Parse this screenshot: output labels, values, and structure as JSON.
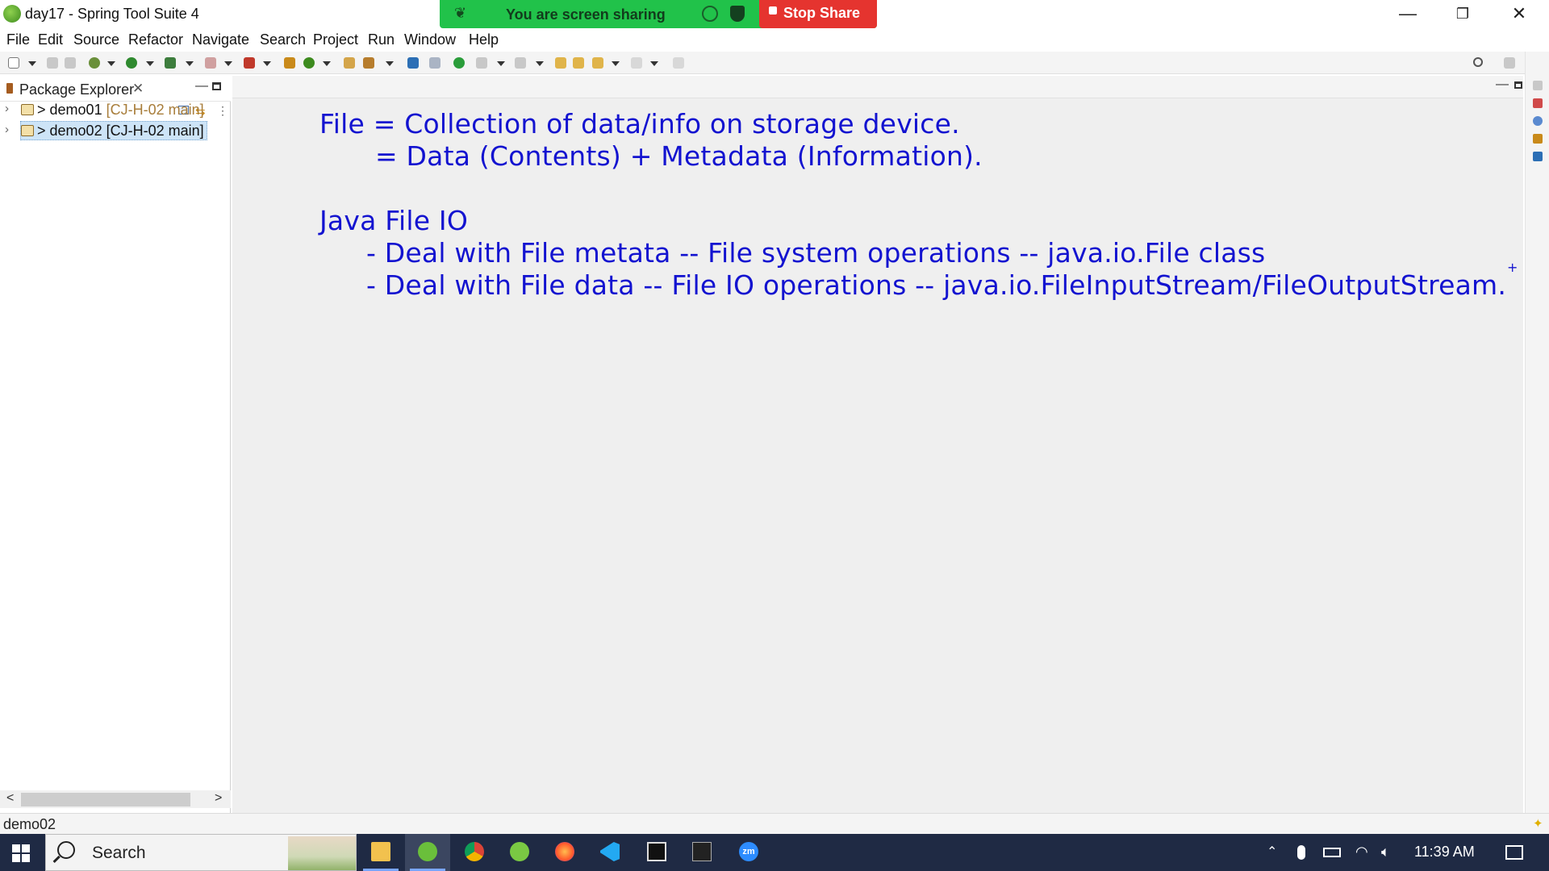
{
  "window": {
    "title": "day17 - Spring Tool Suite 4",
    "controls": {
      "minimize": "—",
      "restore": "❐",
      "close": "✕"
    }
  },
  "screen_share": {
    "status_text": "You are screen sharing",
    "stop_label": "Stop Share",
    "bar_color": "#21c24a",
    "stop_color": "#e5342f"
  },
  "menu": {
    "items": [
      "File",
      "Edit",
      "Source",
      "Refactor",
      "Navigate",
      "Search",
      "Project",
      "Run",
      "Window",
      "Help"
    ]
  },
  "package_explorer": {
    "tab_label": "Package Explorer",
    "close_glyph": "✕",
    "minimize_glyph": "—",
    "items": [
      {
        "chevron": "›",
        "prefix": ">",
        "name": "demo01",
        "branch": "[CJ-H-02 main]",
        "selected": false
      },
      {
        "chevron": "›",
        "prefix": ">",
        "name": "demo02",
        "branch": "[CJ-H-02 main]",
        "selected": true
      }
    ],
    "scroll_left": "<",
    "scroll_right": ">"
  },
  "editor": {
    "minimize_glyph": "—",
    "notes": [
      "File = Collection of data/info on storage device.",
      "= Data (Contents) + Metadata (Information).",
      "Java File IO",
      "- Deal with File metata -- File system operations -- java.io.File class",
      "- Deal with File data -- File IO operations -- java.io.FileInputStream/FileOutputStream.",
      "+"
    ],
    "ink_color": "#1313d0"
  },
  "statusbar": {
    "text": "demo02"
  },
  "taskbar": {
    "search_label": "Search",
    "apps": [
      "file-explorer",
      "spring-tool-suite",
      "chrome",
      "spring-tool-suite-2",
      "firefox",
      "vscode",
      "terminal-window",
      "command-prompt",
      "zoom"
    ],
    "zoom_label": "zm",
    "tray_icons": [
      "chevron-up",
      "microphone",
      "battery",
      "wifi",
      "speaker"
    ],
    "time": "11:39 AM"
  }
}
